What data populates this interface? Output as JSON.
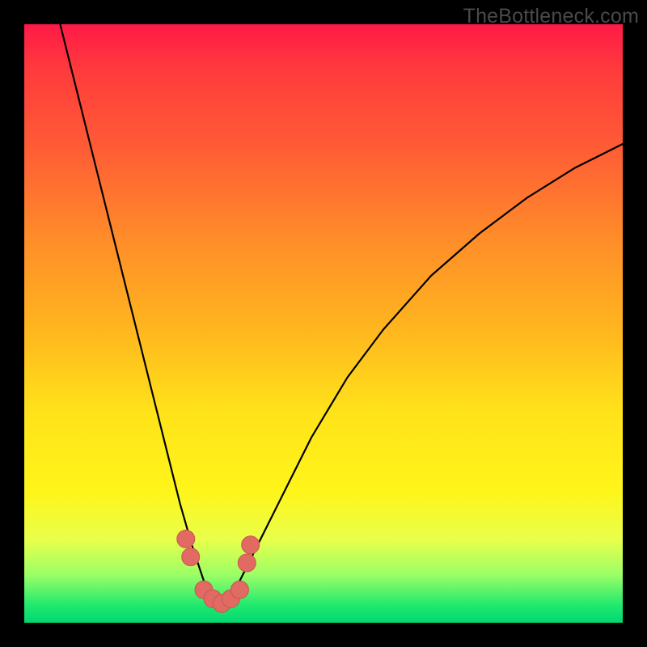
{
  "watermark": "TheBottleneck.com",
  "colors": {
    "frame": "#000000",
    "curve_stroke": "#000000",
    "marker_fill": "#e16a63",
    "marker_stroke": "#c95650"
  },
  "chart_data": {
    "type": "line",
    "title": "",
    "xlabel": "",
    "ylabel": "",
    "xlim": [
      0,
      100
    ],
    "ylim": [
      0,
      100
    ],
    "note": "V-shaped curve with minimum near x≈33; y is percentage of plot height from bottom.",
    "series": [
      {
        "name": "curve",
        "x": [
          6,
          8,
          10,
          12,
          14,
          16,
          18,
          20,
          22,
          24,
          26,
          28,
          30,
          31,
          32,
          33,
          34,
          35,
          36,
          38,
          40,
          44,
          48,
          54,
          60,
          68,
          76,
          84,
          92,
          100
        ],
        "y": [
          100,
          92,
          84,
          76,
          68,
          60,
          52,
          44,
          36,
          28,
          20,
          13,
          7,
          5,
          3.5,
          3,
          3.5,
          5,
          7,
          11,
          15,
          23,
          31,
          41,
          49,
          58,
          65,
          71,
          76,
          80
        ]
      }
    ],
    "markers": {
      "name": "highlight-points",
      "x": [
        27,
        27.8,
        30,
        31.5,
        33,
        34.5,
        36,
        37.2,
        37.8
      ],
      "y": [
        14,
        11,
        5.5,
        4,
        3.2,
        4,
        5.5,
        10,
        13
      ]
    }
  }
}
